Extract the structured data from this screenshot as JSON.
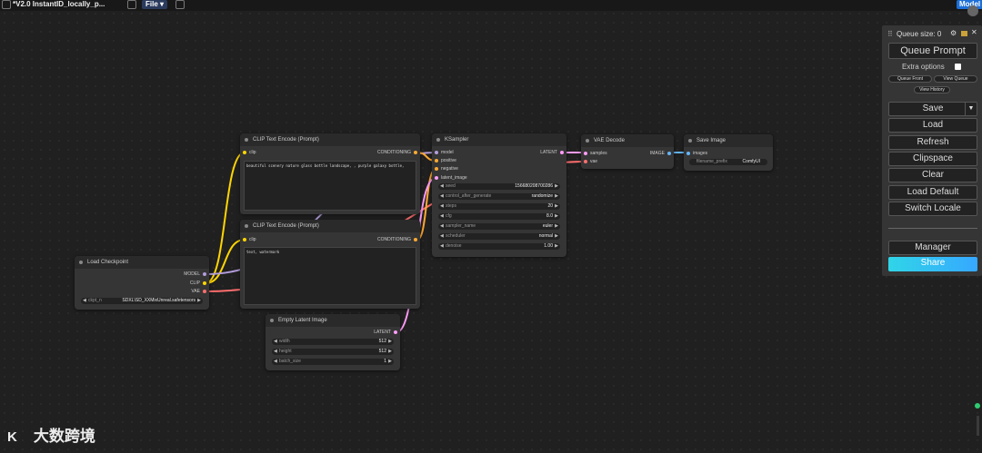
{
  "window": {
    "title": "*V2.0 InstantID_locally_p...",
    "file_menu": "File",
    "file_chevron": "chevron-down-icon",
    "model_button": "Model"
  },
  "nodes": {
    "clip_text_encode_1": {
      "title": "CLIP Text Encode (Prompt)",
      "input": "clip",
      "output": "CONDITIONING",
      "text": "beautiful scenery nature glass bottle landscape, , purple galaxy bottle,"
    },
    "clip_text_encode_2": {
      "title": "CLIP Text Encode (Prompt)",
      "input": "clip",
      "output": "CONDITIONING",
      "text": "text, watermark"
    },
    "ksampler": {
      "title": "KSampler",
      "inputs": [
        "model",
        "positive",
        "negative",
        "latent_image"
      ],
      "output": "LATENT",
      "widgets": [
        {
          "label": "seed",
          "value": "156680208700286"
        },
        {
          "label": "control_after_generate",
          "value": "randomize"
        },
        {
          "label": "steps",
          "value": "20"
        },
        {
          "label": "cfg",
          "value": "8.0"
        },
        {
          "label": "sampler_name",
          "value": "euler"
        },
        {
          "label": "scheduler",
          "value": "normal"
        },
        {
          "label": "denoise",
          "value": "1.00"
        }
      ]
    },
    "vae_decode": {
      "title": "VAE Decode",
      "inputs": [
        "samples",
        "vae"
      ],
      "output": "IMAGE"
    },
    "save_image": {
      "title": "Save Image",
      "input": "images",
      "widget": {
        "label": "filename_prefix",
        "value": "ComfyUI"
      }
    },
    "load_checkpoint": {
      "title": "Load Checkpoint",
      "outputs": [
        "MODEL",
        "CLIP",
        "VAE"
      ],
      "widget": {
        "label": "ckpt_n",
        "value": "SDXL\\SD_XXMixUnreal.safetensors"
      }
    },
    "empty_latent": {
      "title": "Empty Latent Image",
      "output": "LATENT",
      "widgets": [
        {
          "label": "width",
          "value": "512"
        },
        {
          "label": "height",
          "value": "512"
        },
        {
          "label": "batch_size",
          "value": "1"
        }
      ]
    }
  },
  "queue_panel": {
    "queue_size": "Queue size: 0",
    "queue_prompt": "Queue Prompt",
    "extra_options": "Extra options",
    "queue_front": "Queue Front",
    "view_queue": "View Queue",
    "view_history": "View History",
    "save": "Save",
    "load": "Load",
    "refresh": "Refresh",
    "clipspace": "Clipspace",
    "clear": "Clear",
    "load_default": "Load Default",
    "switch_locale": "Switch Locale",
    "manager": "Manager",
    "share": "Share"
  },
  "watermark": "大数跨境",
  "colors": {
    "clip_wire": "#ffd500",
    "model_wire": "#b39ddb",
    "vae_wire": "#ff6e6e",
    "conditioning_wire": "#ffa931",
    "latent_wire": "#ff9cf9",
    "image_wire": "#64b5f6",
    "share_gradient_start": "#30d5e8",
    "share_gradient_end": "#36a8ff"
  }
}
